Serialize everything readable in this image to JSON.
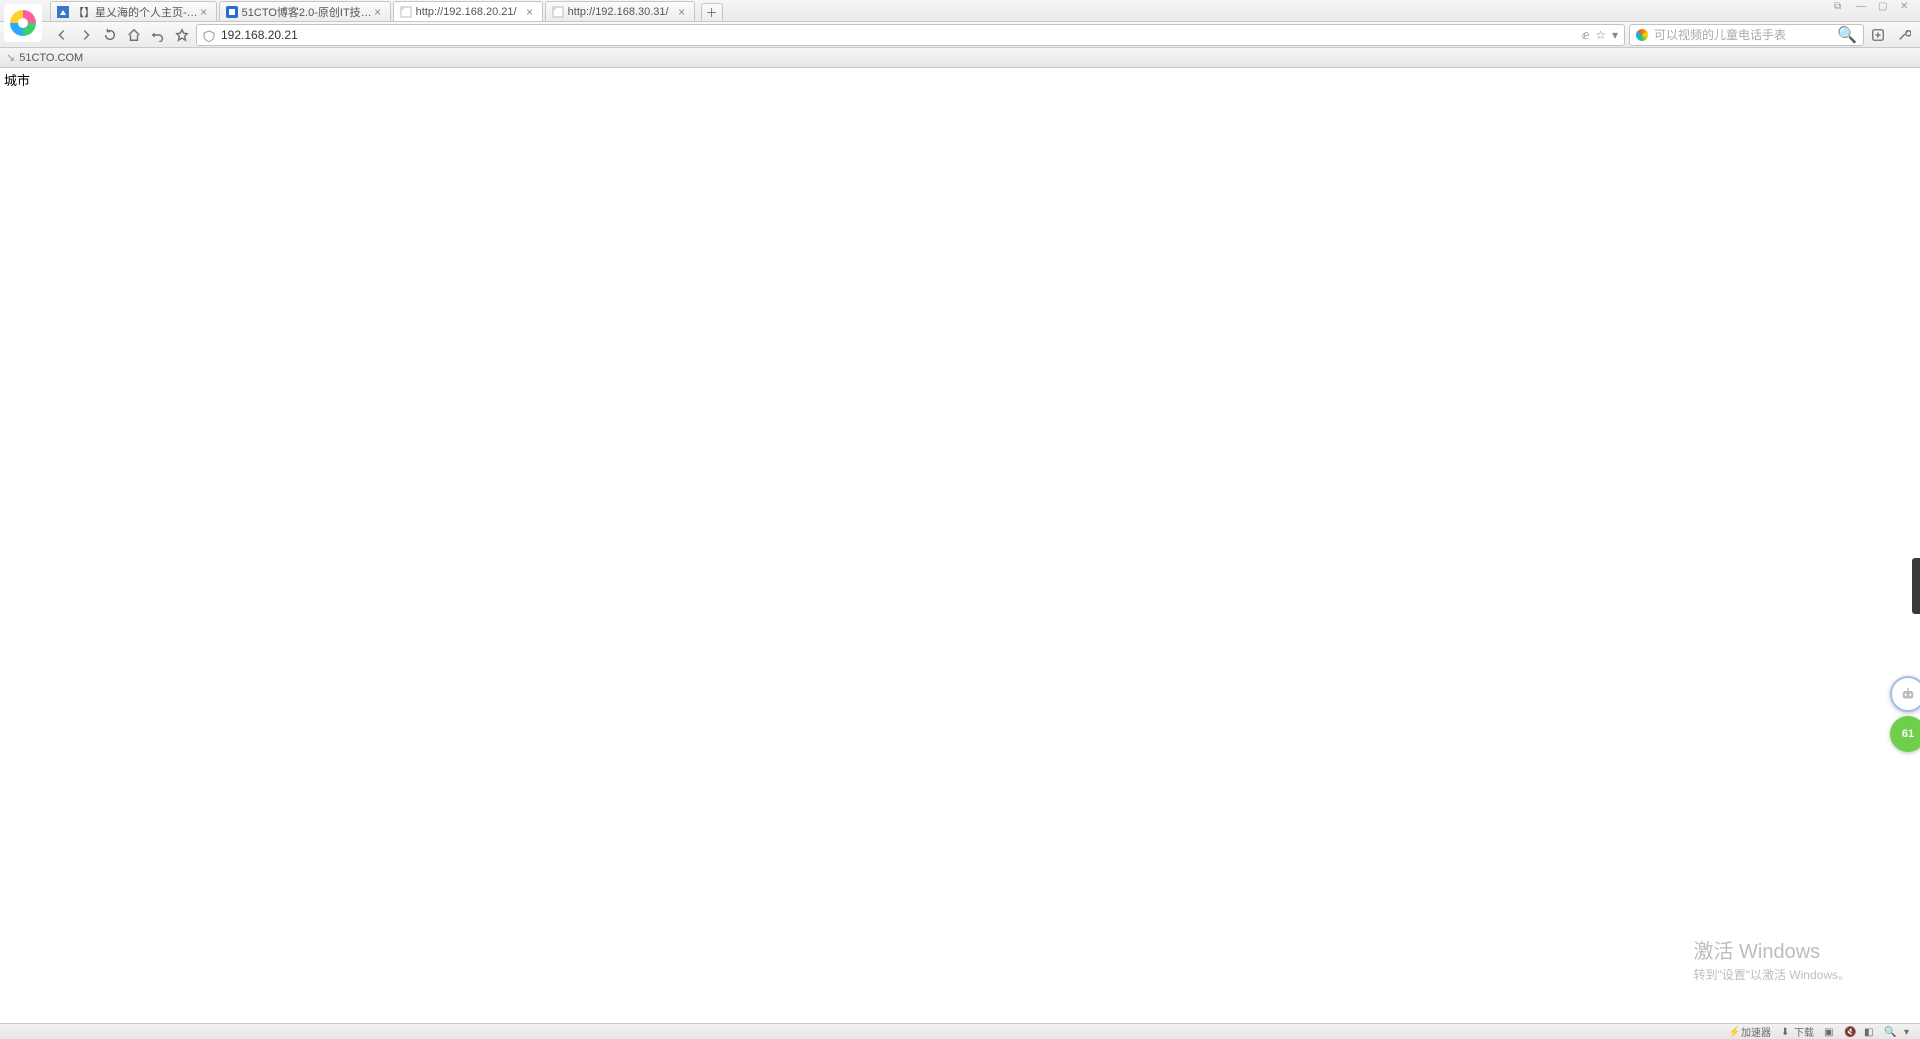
{
  "tabs": [
    {
      "title": "【】星乂海的个人主页-…",
      "favicon": "blue-doc"
    },
    {
      "title": "51CTO博客2.0-原创IT技…",
      "favicon": "blue-square"
    },
    {
      "title": "http://192.168.20.21/",
      "favicon": "page",
      "active": true
    },
    {
      "title": "http://192.168.30.31/",
      "favicon": "page"
    }
  ],
  "addressbar": {
    "url": "192.168.20.21"
  },
  "searchbox": {
    "placeholder": "可以视频的儿童电话手表"
  },
  "bookmarks": {
    "label": "51CTO.COM"
  },
  "page": {
    "body_text": "城市"
  },
  "activation": {
    "line1": "激活 Windows",
    "line2": "转到\"设置\"以激活 Windows。"
  },
  "side_green_badge": "61",
  "status": {
    "accel": "加速器",
    "download": "下载"
  }
}
